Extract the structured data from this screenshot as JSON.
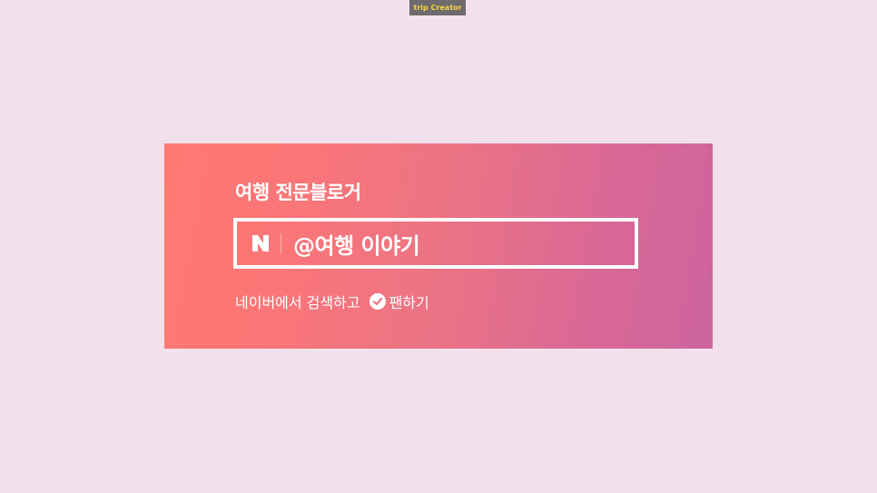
{
  "top_badge": {
    "label": "trip Creator"
  },
  "card": {
    "title": "여행 전문블로거",
    "search": {
      "logo_icon": "naver-n-icon",
      "query": "@여행 이야기"
    },
    "prompt_text": "네이버에서 검색하고",
    "fan_icon": "check-circle-icon",
    "fan_label": "팬하기"
  },
  "colors": {
    "background": "#f2e1ec",
    "card_gradient_start": "#ff7874",
    "card_gradient_end": "#cd649f",
    "badge_bg": "#6f6a6d",
    "badge_text": "#f4d34a"
  }
}
